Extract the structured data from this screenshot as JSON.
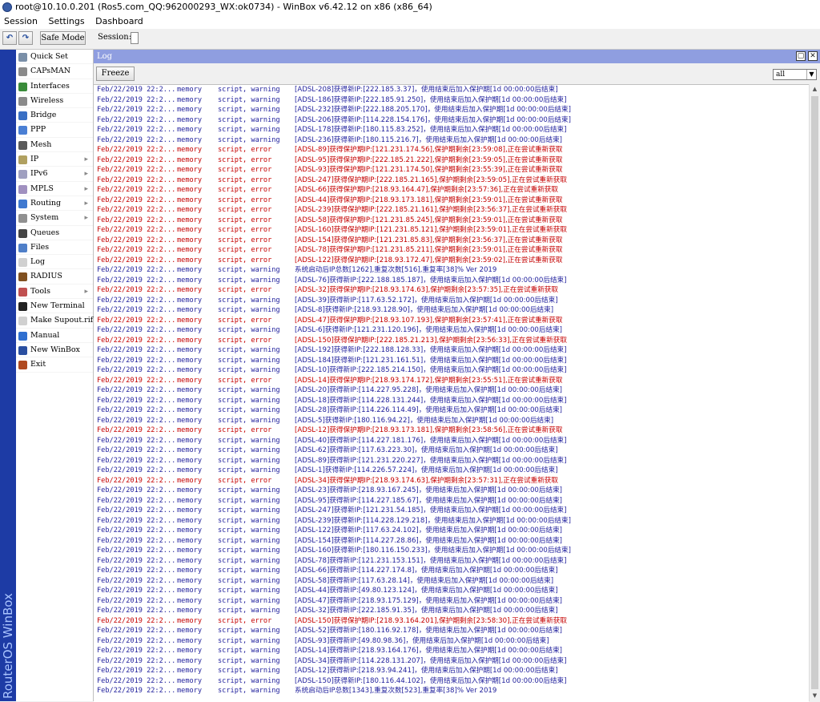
{
  "titlebar": {
    "text": "root@10.10.0.201 (Ros5.com_QQ:962000293_WX:ok0734) - WinBox v6.42.12 on x86 (x86_64)"
  },
  "menubar": {
    "items": [
      "Session",
      "Settings",
      "Dashboard"
    ]
  },
  "toolbar": {
    "undo_icon": "undo-icon",
    "redo_icon": "redo-icon",
    "safe_mode": "Safe Mode",
    "session_label": "Session:"
  },
  "brand": {
    "vertical": "RouterOS WinBox"
  },
  "sidebar": {
    "items": [
      {
        "label": "Quick Set",
        "icon": "quick-set-icon",
        "color": "#7a8fa8",
        "arrow": false
      },
      {
        "label": "CAPsMAN",
        "icon": "capsman-icon",
        "color": "#8a8a8a",
        "arrow": false
      },
      {
        "label": "Interfaces",
        "icon": "interfaces-icon",
        "color": "#3a8c3a",
        "arrow": false
      },
      {
        "label": "Wireless",
        "icon": "wireless-icon",
        "color": "#8a8a8a",
        "arrow": false
      },
      {
        "label": "Bridge",
        "icon": "bridge-icon",
        "color": "#3a6fc4",
        "arrow": false
      },
      {
        "label": "PPP",
        "icon": "ppp-icon",
        "color": "#4a7fd4",
        "arrow": false
      },
      {
        "label": "Mesh",
        "icon": "mesh-icon",
        "color": "#5a5a5a",
        "arrow": false
      },
      {
        "label": "IP",
        "icon": "ip-icon",
        "color": "#b0a060",
        "arrow": true
      },
      {
        "label": "IPv6",
        "icon": "ipv6-icon",
        "color": "#a0a0c0",
        "arrow": true
      },
      {
        "label": "MPLS",
        "icon": "mpls-icon",
        "color": "#a090c0",
        "arrow": true
      },
      {
        "label": "Routing",
        "icon": "routing-icon",
        "color": "#3f79d0",
        "arrow": true
      },
      {
        "label": "System",
        "icon": "system-icon",
        "color": "#909090",
        "arrow": true
      },
      {
        "label": "Queues",
        "icon": "queues-icon",
        "color": "#444444",
        "arrow": false
      },
      {
        "label": "Files",
        "icon": "files-icon",
        "color": "#4f7fc8",
        "arrow": false
      },
      {
        "label": "Log",
        "icon": "log-icon",
        "color": "#d0d0d0",
        "arrow": false
      },
      {
        "label": "RADIUS",
        "icon": "radius-icon",
        "color": "#805020",
        "arrow": false
      },
      {
        "label": "Tools",
        "icon": "tools-icon",
        "color": "#c05050",
        "arrow": true
      },
      {
        "label": "New Terminal",
        "icon": "terminal-icon",
        "color": "#222222",
        "arrow": false
      },
      {
        "label": "Make Supout.rif",
        "icon": "supout-icon",
        "color": "#d0d0d0",
        "arrow": false
      },
      {
        "label": "Manual",
        "icon": "manual-icon",
        "color": "#2f6fd0",
        "arrow": false
      },
      {
        "label": "New WinBox",
        "icon": "winbox-icon",
        "color": "#2a4fa0",
        "arrow": false
      },
      {
        "label": "Exit",
        "icon": "exit-icon",
        "color": "#b04a20",
        "arrow": false
      }
    ]
  },
  "log": {
    "title": "Log",
    "freeze": "Freeze",
    "filter": "all",
    "time": "Feb/22/2019 22:2...",
    "buffer": "memory",
    "rows": [
      {
        "t": "script, warning",
        "m": "[ADSL-208]获得新IP:[222.185.3.37]，使用结束后加入保护期[1d 00:00:00后结束]"
      },
      {
        "t": "script, warning",
        "m": "[ADSL-186]获得新IP:[222.185.91.250]，使用结束后加入保护期[1d 00:00:00后结束]"
      },
      {
        "t": "script, warning",
        "m": "[ADSL-232]获得新IP:[222.188.205.170]，使用结束后加入保护期[1d 00:00:00后结束]"
      },
      {
        "t": "script, warning",
        "m": "[ADSL-206]获得新IP:[114.228.154.176]，使用结束后加入保护期[1d 00:00:00后结束]"
      },
      {
        "t": "script, warning",
        "m": "[ADSL-178]获得新IP:[180.115.83.252]，使用结束后加入保护期[1d 00:00:00后结束]"
      },
      {
        "t": "script, warning",
        "m": "[ADSL-236]获得新IP:[180.115.216.7]，使用结束后加入保护期[1d 00:00:00后结束]"
      },
      {
        "t": "script, error",
        "m": "[ADSL-89]获得保护期IP:[121.231.174.56],保护期剩余[23:59:08],正在尝试重新获取"
      },
      {
        "t": "script, error",
        "m": "[ADSL-95]获得保护期IP:[222.185.21.222],保护期剩余[23:59:05],正在尝试重新获取"
      },
      {
        "t": "script, error",
        "m": "[ADSL-93]获得保护期IP:[121.231.174.50],保护期剩余[23:55:39],正在尝试重新获取"
      },
      {
        "t": "script, error",
        "m": "[ADSL-247]获得保护期IP:[222.185.21.165],保护期剩余[23:59:05],正在尝试重新获取"
      },
      {
        "t": "script, error",
        "m": "[ADSL-66]获得保护期IP:[218.93.164.47],保护期剩余[23:57:36],正在尝试重新获取"
      },
      {
        "t": "script, error",
        "m": "[ADSL-44]获得保护期IP:[218.93.173.181],保护期剩余[23:59:01],正在尝试重新获取"
      },
      {
        "t": "script, error",
        "m": "[ADSL-239]获得保护期IP:[222.185.21.161],保护期剩余[23:56:37],正在尝试重新获取"
      },
      {
        "t": "script, error",
        "m": "[ADSL-58]获得保护期IP:[121.231.85.245],保护期剩余[23:59:01],正在尝试重新获取"
      },
      {
        "t": "script, error",
        "m": "[ADSL-160]获得保护期IP:[121.231.85.121],保护期剩余[23:59:01],正在尝试重新获取"
      },
      {
        "t": "script, error",
        "m": "[ADSL-154]获得保护期IP:[121.231.85.83],保护期剩余[23:56:37],正在尝试重新获取"
      },
      {
        "t": "script, error",
        "m": "[ADSL-78]获得保护期IP:[121.231.85.211],保护期剩余[23:59:01],正在尝试重新获取"
      },
      {
        "t": "script, error",
        "m": "[ADSL-122]获得保护期IP:[218.93.172.47],保护期剩余[23:59:02],正在尝试重新获取"
      },
      {
        "t": "script, warning",
        "m": "系统启动后IP总数[1262],重复次数[516],重复率[38]% Ver 2019"
      },
      {
        "t": "script, warning",
        "m": "[ADSL-76]获得新IP:[222.188.185.187]，使用结束后加入保护期[1d 00:00:00后结束]"
      },
      {
        "t": "script, error",
        "m": "[ADSL-32]获得保护期IP:[218.93.174.63],保护期剩余[23:57:35],正在尝试重新获取"
      },
      {
        "t": "script, warning",
        "m": "[ADSL-39]获得新IP:[117.63.52.172]，使用结束后加入保护期[1d 00:00:00后结束]"
      },
      {
        "t": "script, warning",
        "m": "[ADSL-8]获得新IP:[218.93.128.90]，使用结束后加入保护期[1d 00:00:00后结束]"
      },
      {
        "t": "script, error",
        "m": "[ADSL-47]获得保护期IP:[218.93.107.193],保护期剩余[23:57:41],正在尝试重新获取"
      },
      {
        "t": "script, warning",
        "m": "[ADSL-6]获得新IP:[121.231.120.196]，使用结束后加入保护期[1d 00:00:00后结束]"
      },
      {
        "t": "script, error",
        "m": "[ADSL-150]获得保护期IP:[222.185.21.213],保护期剩余[23:56:33],正在尝试重新获取"
      },
      {
        "t": "script, warning",
        "m": "[ADSL-192]获得新IP:[222.188.128.33]，使用结束后加入保护期[1d 00:00:00后结束]"
      },
      {
        "t": "script, warning",
        "m": "[ADSL-184]获得新IP:[121.231.161.51]，使用结束后加入保护期[1d 00:00:00后结束]"
      },
      {
        "t": "script, warning",
        "m": "[ADSL-10]获得新IP:[222.185.214.150]，使用结束后加入保护期[1d 00:00:00后结束]"
      },
      {
        "t": "script, error",
        "m": "[ADSL-14]获得保护期IP:[218.93.174.172],保护期剩余[23:55:51],正在尝试重新获取"
      },
      {
        "t": "script, warning",
        "m": "[ADSL-20]获得新IP:[114.227.95.228]，使用结束后加入保护期[1d 00:00:00后结束]"
      },
      {
        "t": "script, warning",
        "m": "[ADSL-18]获得新IP:[114.228.131.244]，使用结束后加入保护期[1d 00:00:00后结束]"
      },
      {
        "t": "script, warning",
        "m": "[ADSL-28]获得新IP:[114.226.114.49]，使用结束后加入保护期[1d 00:00:00后结束]"
      },
      {
        "t": "script, warning",
        "m": "[ADSL-5]获得新IP:[180.116.94.22]，使用结束后加入保护期[1d 00:00:00后结束]"
      },
      {
        "t": "script, error",
        "m": "[ADSL-12]获得保护期IP:[218.93.173.181],保护期剩余[23:58:56],正在尝试重新获取"
      },
      {
        "t": "script, warning",
        "m": "[ADSL-40]获得新IP:[114.227.181.176]，使用结束后加入保护期[1d 00:00:00后结束]"
      },
      {
        "t": "script, warning",
        "m": "[ADSL-62]获得新IP:[117.63.223.30]，使用结束后加入保护期[1d 00:00:00后结束]"
      },
      {
        "t": "script, warning",
        "m": "[ADSL-89]获得新IP:[121.231.220.227]，使用结束后加入保护期[1d 00:00:00后结束]"
      },
      {
        "t": "script, warning",
        "m": "[ADSL-1]获得新IP:[114.226.57.224]，使用结束后加入保护期[1d 00:00:00后结束]"
      },
      {
        "t": "script, error",
        "m": "[ADSL-34]获得保护期IP:[218.93.174.63],保护期剩余[23:57:31],正在尝试重新获取"
      },
      {
        "t": "script, warning",
        "m": "[ADSL-23]获得新IP:[218.93.167.245]，使用结束后加入保护期[1d 00:00:00后结束]"
      },
      {
        "t": "script, warning",
        "m": "[ADSL-95]获得新IP:[114.227.185.67]，使用结束后加入保护期[1d 00:00:00后结束]"
      },
      {
        "t": "script, warning",
        "m": "[ADSL-247]获得新IP:[121.231.54.185]，使用结束后加入保护期[1d 00:00:00后结束]"
      },
      {
        "t": "script, warning",
        "m": "[ADSL-239]获得新IP:[114.228.129.218]，使用结束后加入保护期[1d 00:00:00后结束]"
      },
      {
        "t": "script, warning",
        "m": "[ADSL-122]获得新IP:[117.63.24.102]，使用结束后加入保护期[1d 00:00:00后结束]"
      },
      {
        "t": "script, warning",
        "m": "[ADSL-154]获得新IP:[114.227.28.86]，使用结束后加入保护期[1d 00:00:00后结束]"
      },
      {
        "t": "script, warning",
        "m": "[ADSL-160]获得新IP:[180.116.150.233]，使用结束后加入保护期[1d 00:00:00后结束]"
      },
      {
        "t": "script, warning",
        "m": "[ADSL-78]获得新IP:[121.231.153.151]，使用结束后加入保护期[1d 00:00:00后结束]"
      },
      {
        "t": "script, warning",
        "m": "[ADSL-66]获得新IP:[114.227.174.8]，使用结束后加入保护期[1d 00:00:00后结束]"
      },
      {
        "t": "script, warning",
        "m": "[ADSL-58]获得新IP:[117.63.28.14]，使用结束后加入保护期[1d 00:00:00后结束]"
      },
      {
        "t": "script, warning",
        "m": "[ADSL-44]获得新IP:[49.80.123.124]，使用结束后加入保护期[1d 00:00:00后结束]"
      },
      {
        "t": "script, warning",
        "m": "[ADSL-47]获得新IP:[218.93.175.129]，使用结束后加入保护期[1d 00:00:00后结束]"
      },
      {
        "t": "script, warning",
        "m": "[ADSL-32]获得新IP:[222.185.91.35]，使用结束后加入保护期[1d 00:00:00后结束]"
      },
      {
        "t": "script, error",
        "m": "[ADSL-150]获得保护期IP:[218.93.164.201],保护期剩余[23:58:30],正在尝试重新获取"
      },
      {
        "t": "script, warning",
        "m": "[ADSL-52]获得新IP:[180.116.92.178]，使用结束后加入保护期[1d 00:00:00后结束]"
      },
      {
        "t": "script, warning",
        "m": "[ADSL-93]获得新IP:[49.80.98.36]，使用结束后加入保护期[1d 00:00:00后结束]"
      },
      {
        "t": "script, warning",
        "m": "[ADSL-14]获得新IP:[218.93.164.176]，使用结束后加入保护期[1d 00:00:00后结束]"
      },
      {
        "t": "script, warning",
        "m": "[ADSL-34]获得新IP:[114.228.131.207]，使用结束后加入保护期[1d 00:00:00后结束]"
      },
      {
        "t": "script, warning",
        "m": "[ADSL-12]获得新IP:[218.93.94.241]，使用结束后加入保护期[1d 00:00:00后结束]"
      },
      {
        "t": "script, warning",
        "m": "[ADSL-150]获得新IP:[180.116.44.102]，使用结束后加入保护期[1d 00:00:00后结束]"
      },
      {
        "t": "script, warning",
        "m": "系统启动后IP总数[1343],重复次数[523],重复率[38]% Ver 2019"
      }
    ]
  }
}
